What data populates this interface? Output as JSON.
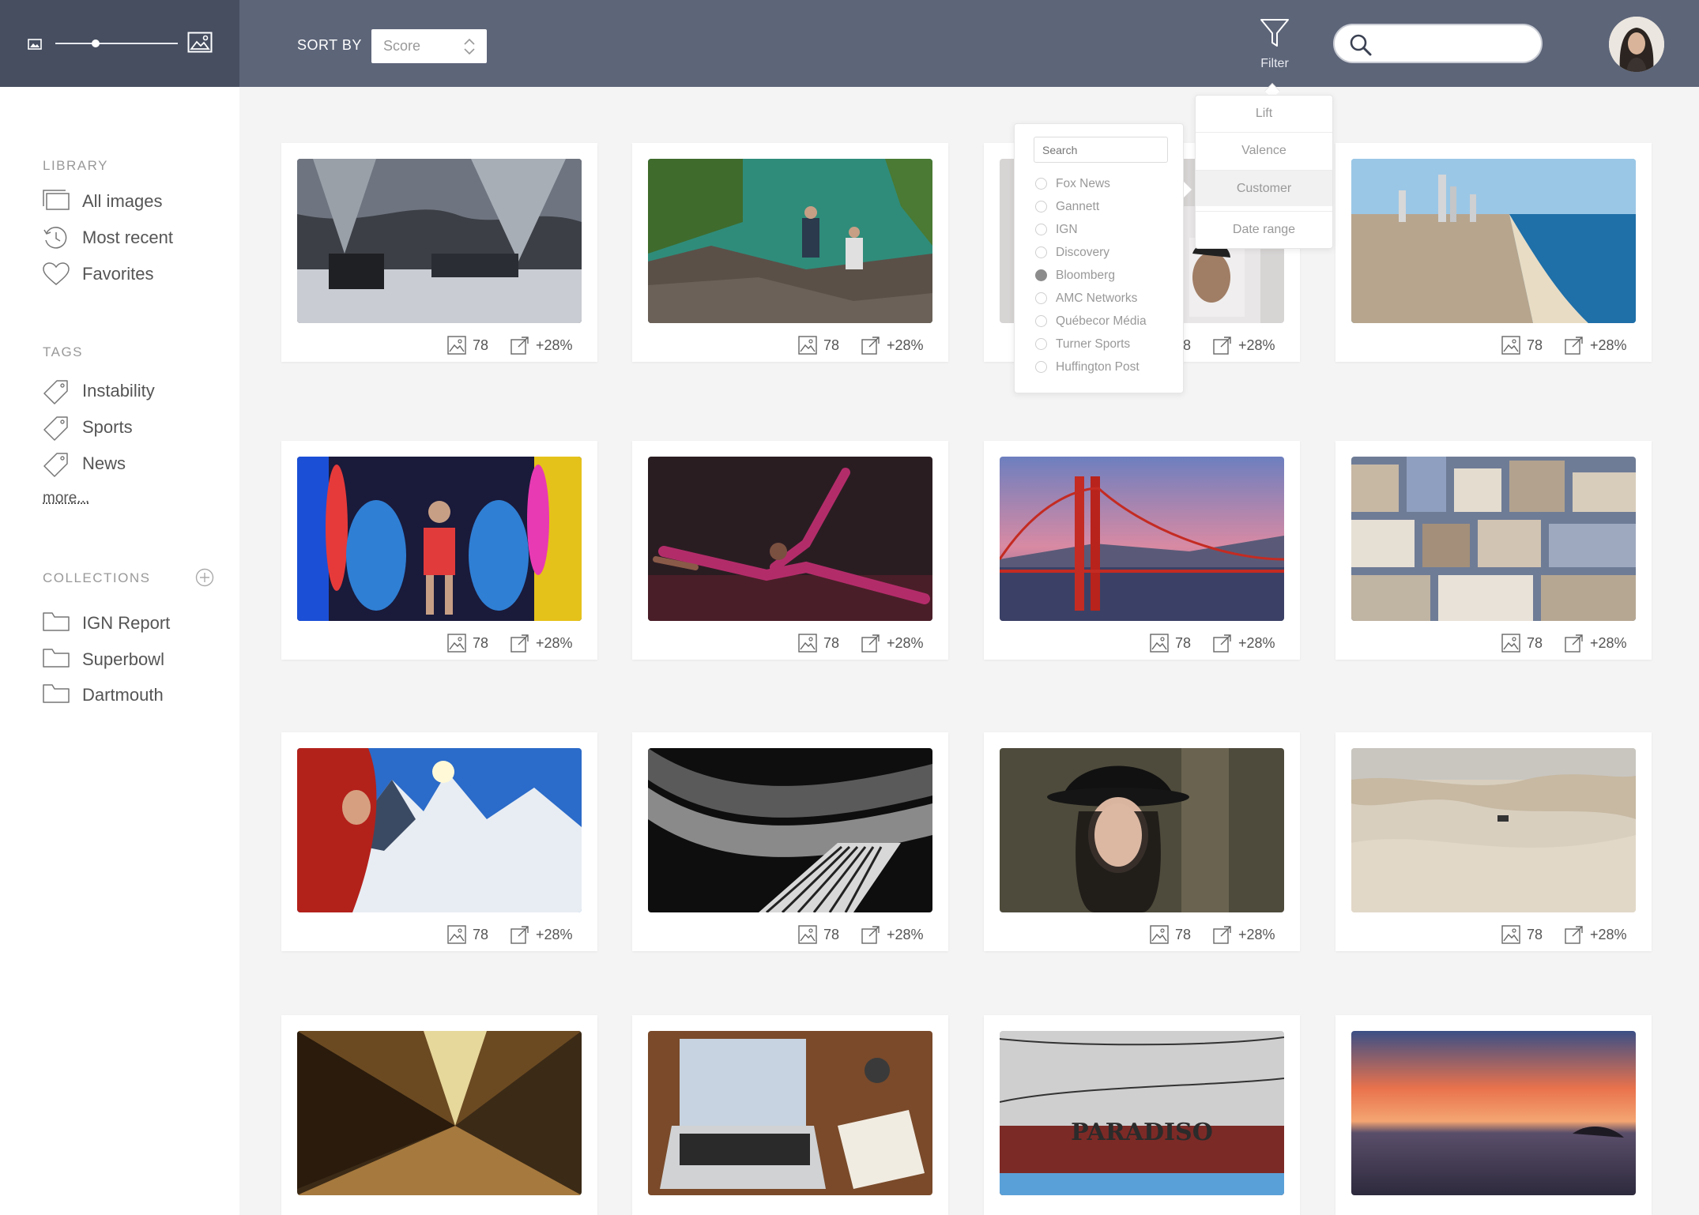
{
  "toolbar": {
    "sort_label": "SORT BY",
    "sort_value": "Score",
    "filter_label": "Filter",
    "search_value": ""
  },
  "sidebar": {
    "library_title": "LIBRARY",
    "library_items": [
      {
        "label": "All images",
        "icon": "all-images-icon"
      },
      {
        "label": "Most recent",
        "icon": "clock-icon"
      },
      {
        "label": "Favorites",
        "icon": "heart-icon"
      }
    ],
    "tags_title": "TAGS",
    "tags": [
      "Instability",
      "Sports",
      "News"
    ],
    "more_label": "more...",
    "collections_title": "COLLECTIONS",
    "collections": [
      "IGN Report",
      "Superbowl",
      "Dartmouth"
    ]
  },
  "filter_panel": {
    "search_placeholder": "Search",
    "options": [
      "Fox News",
      "Gannett",
      "IGN",
      "Discovery",
      "Bloomberg",
      "AMC Networks",
      "Québecor Média",
      "Turner Sports",
      "Huffington Post"
    ],
    "selected": "Bloomberg"
  },
  "filter_menu": {
    "items": [
      "Lift",
      "Valence",
      "Customer",
      "Date range"
    ],
    "active": "Customer"
  },
  "cards": [
    {
      "count": "78",
      "lift": "+28%",
      "scene": "snowy-forest"
    },
    {
      "count": "78",
      "lift": "+28%",
      "scene": "river-cliff"
    },
    {
      "count": "78",
      "lift": "+28%",
      "scene": "portrait-posters"
    },
    {
      "count": "78",
      "lift": "+28%",
      "scene": "coastal-city"
    },
    {
      "count": "78",
      "lift": "+28%",
      "scene": "concert-sharks"
    },
    {
      "count": "78",
      "lift": "+28%",
      "scene": "gymnast"
    },
    {
      "count": "78",
      "lift": "+28%",
      "scene": "golden-gate-bridge"
    },
    {
      "count": "78",
      "lift": "+28%",
      "scene": "city-houses"
    },
    {
      "count": "78",
      "lift": "+28%",
      "scene": "mountain-climber"
    },
    {
      "count": "78",
      "lift": "+28%",
      "scene": "piano-keys"
    },
    {
      "count": "78",
      "lift": "+28%",
      "scene": "woman-hat"
    },
    {
      "count": "78",
      "lift": "+28%",
      "scene": "desert-dunes"
    },
    {
      "count": "",
      "lift": "",
      "scene": "train-window"
    },
    {
      "count": "",
      "lift": "",
      "scene": "laptop-desk"
    },
    {
      "count": "",
      "lift": "",
      "scene": "paradiso-sign",
      "sign_text": "PARADISO"
    },
    {
      "count": "",
      "lift": "",
      "scene": "sunset-sea"
    }
  ],
  "colors": {
    "topbar": "#5d6579",
    "topbar_left": "#464e60",
    "background": "#f4f4f4"
  }
}
